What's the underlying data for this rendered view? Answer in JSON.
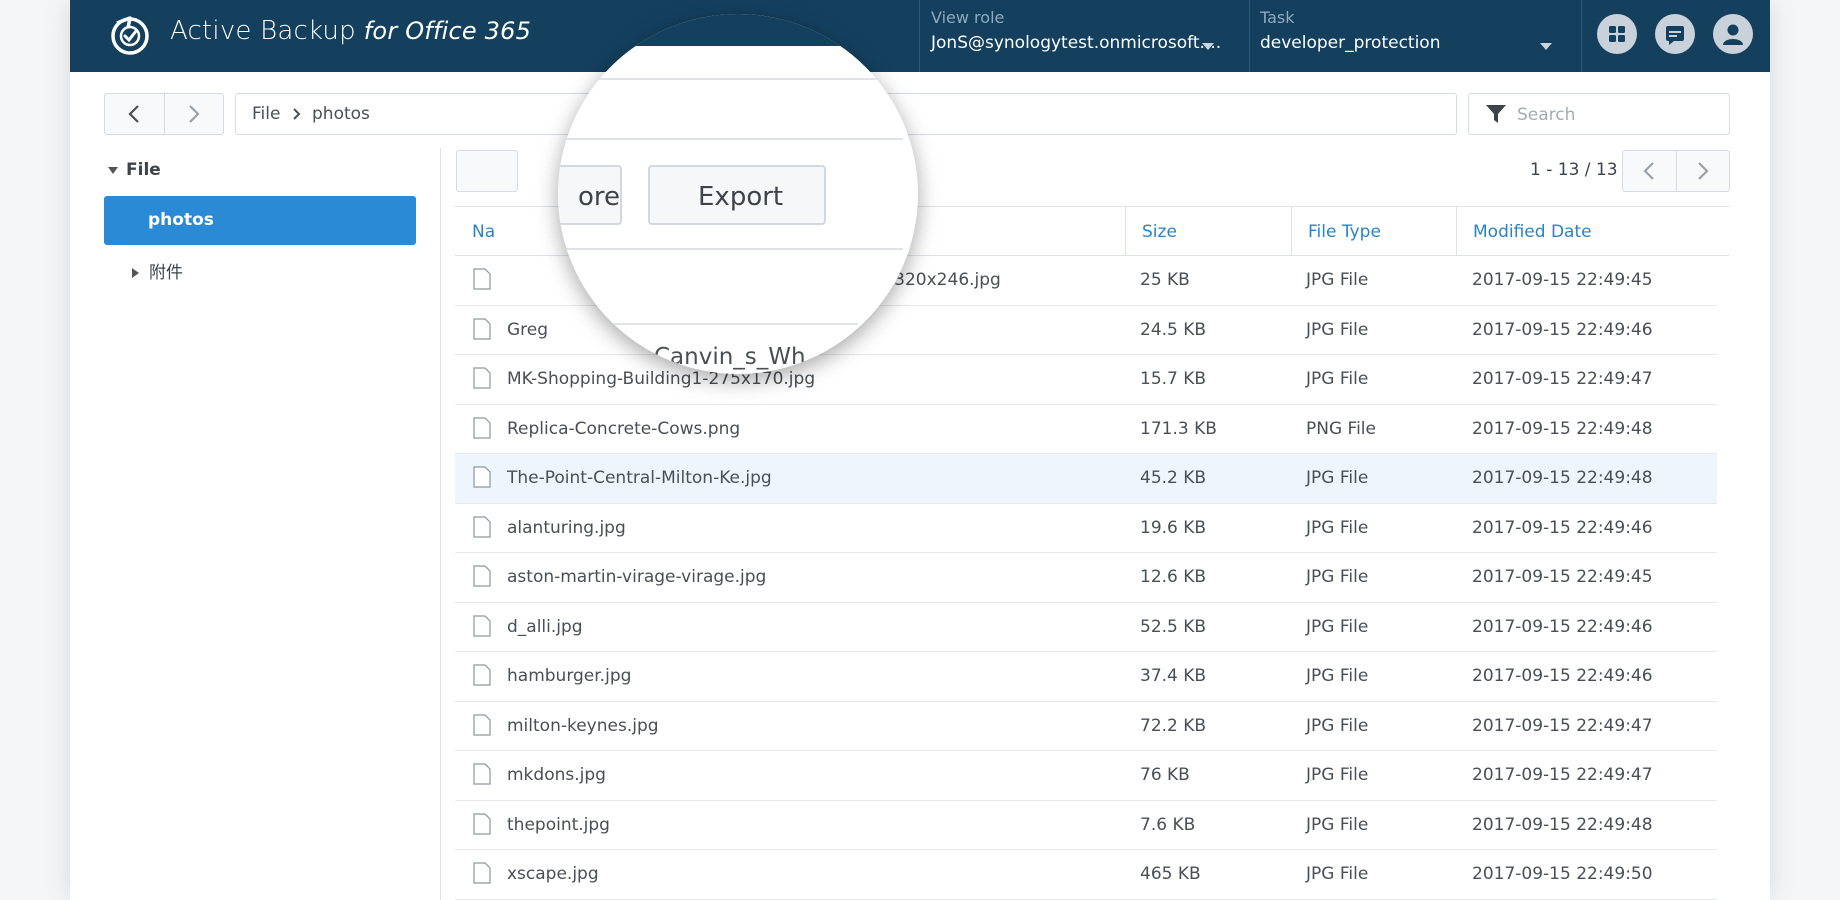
{
  "header": {
    "app_title": "Active Backup",
    "app_subtitle": "for Office 365",
    "view_role_label": "View role",
    "view_role_value": "JonS@synologytest.onmicrosoft....",
    "task_label": "Task",
    "task_value": "developer_protection"
  },
  "breadcrumb": {
    "root": "File",
    "current": "photos"
  },
  "search": {
    "placeholder": "Search"
  },
  "tree": {
    "root_label": "File",
    "selected_label": "photos",
    "child_label": "附件"
  },
  "toolbar": {
    "restore_label_partial": "ore",
    "export_label": "Export"
  },
  "pagination": {
    "info": "1 - 13 / 13"
  },
  "table": {
    "headers": {
      "name_partial": "Na",
      "size": "Size",
      "type": "File Type",
      "date": "Modified Date"
    },
    "rows": [
      {
        "name": "_bridge-320x246.jpg",
        "size": "25 KB",
        "type": "JPG File",
        "date": "2017-09-15 22:49:45"
      },
      {
        "name": "Greg",
        "size": "24.5 KB",
        "type": "JPG File",
        "date": "2017-09-15 22:49:46"
      },
      {
        "name": "MK-Shopping-Building1-275x170.jpg",
        "size": "15.7 KB",
        "type": "JPG File",
        "date": "2017-09-15 22:49:47"
      },
      {
        "name": "Replica-Concrete-Cows.png",
        "size": "171.3 KB",
        "type": "PNG File",
        "date": "2017-09-15 22:49:48"
      },
      {
        "name": "The-Point-Central-Milton-Ke.jpg",
        "size": "45.2 KB",
        "type": "JPG File",
        "date": "2017-09-15 22:49:48"
      },
      {
        "name": "alanturing.jpg",
        "size": "19.6 KB",
        "type": "JPG File",
        "date": "2017-09-15 22:49:46"
      },
      {
        "name": "aston-martin-virage-virage.jpg",
        "size": "12.6 KB",
        "type": "JPG File",
        "date": "2017-09-15 22:49:45"
      },
      {
        "name": "d_alli.jpg",
        "size": "52.5 KB",
        "type": "JPG File",
        "date": "2017-09-15 22:49:46"
      },
      {
        "name": "hamburger.jpg",
        "size": "37.4 KB",
        "type": "JPG File",
        "date": "2017-09-15 22:49:46"
      },
      {
        "name": "milton-keynes.jpg",
        "size": "72.2 KB",
        "type": "JPG File",
        "date": "2017-09-15 22:49:47"
      },
      {
        "name": "mkdons.jpg",
        "size": "76 KB",
        "type": "JPG File",
        "date": "2017-09-15 22:49:47"
      },
      {
        "name": "thepoint.jpg",
        "size": "7.6 KB",
        "type": "JPG File",
        "date": "2017-09-15 22:49:48"
      },
      {
        "name": "xscape.jpg",
        "size": "465 KB",
        "type": "JPG File",
        "date": "2017-09-15 22:49:50"
      }
    ]
  },
  "magnifier": {
    "text_partial": "Canvin_s_Wh"
  },
  "icons": {
    "logo": "active-backup-logo-icon",
    "apps": "apps-grid-icon",
    "messages": "message-icon",
    "user": "user-icon",
    "filter": "filter-icon",
    "file": "file-icon"
  },
  "colors": {
    "header_bg": "#14405e",
    "accent": "#2b8ad6",
    "header_link": "#2b83c3",
    "row_highlight": "#eef5fc"
  }
}
